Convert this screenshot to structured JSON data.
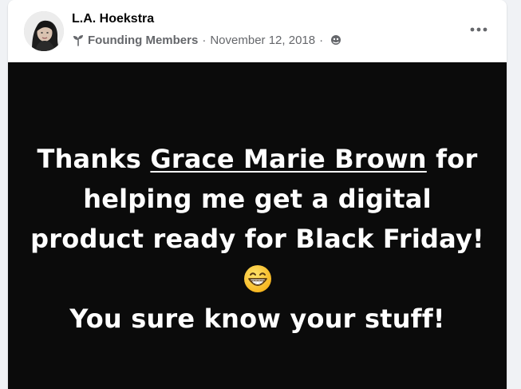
{
  "post": {
    "author": "L.A. Hoekstra",
    "badge": "Founding Members",
    "separator": "·",
    "date": "November 12, 2018",
    "audience_icon": "globe-icon",
    "more_icon": "more-horizontal-icon",
    "badge_icon": "sprout-icon"
  },
  "content": {
    "line1_pre": "Thanks ",
    "mention": "Grace Marie Brown",
    "line1_post": " for",
    "line2": "helping me get a digital",
    "line3": "product ready for Black Friday!",
    "emoji": "grinning-face-emoji",
    "line5": "You sure know your stuff!"
  },
  "colors": {
    "post_background": "#0b0b0b",
    "post_text": "#ffffff",
    "meta_text": "#65676b",
    "author_text": "#050505"
  }
}
